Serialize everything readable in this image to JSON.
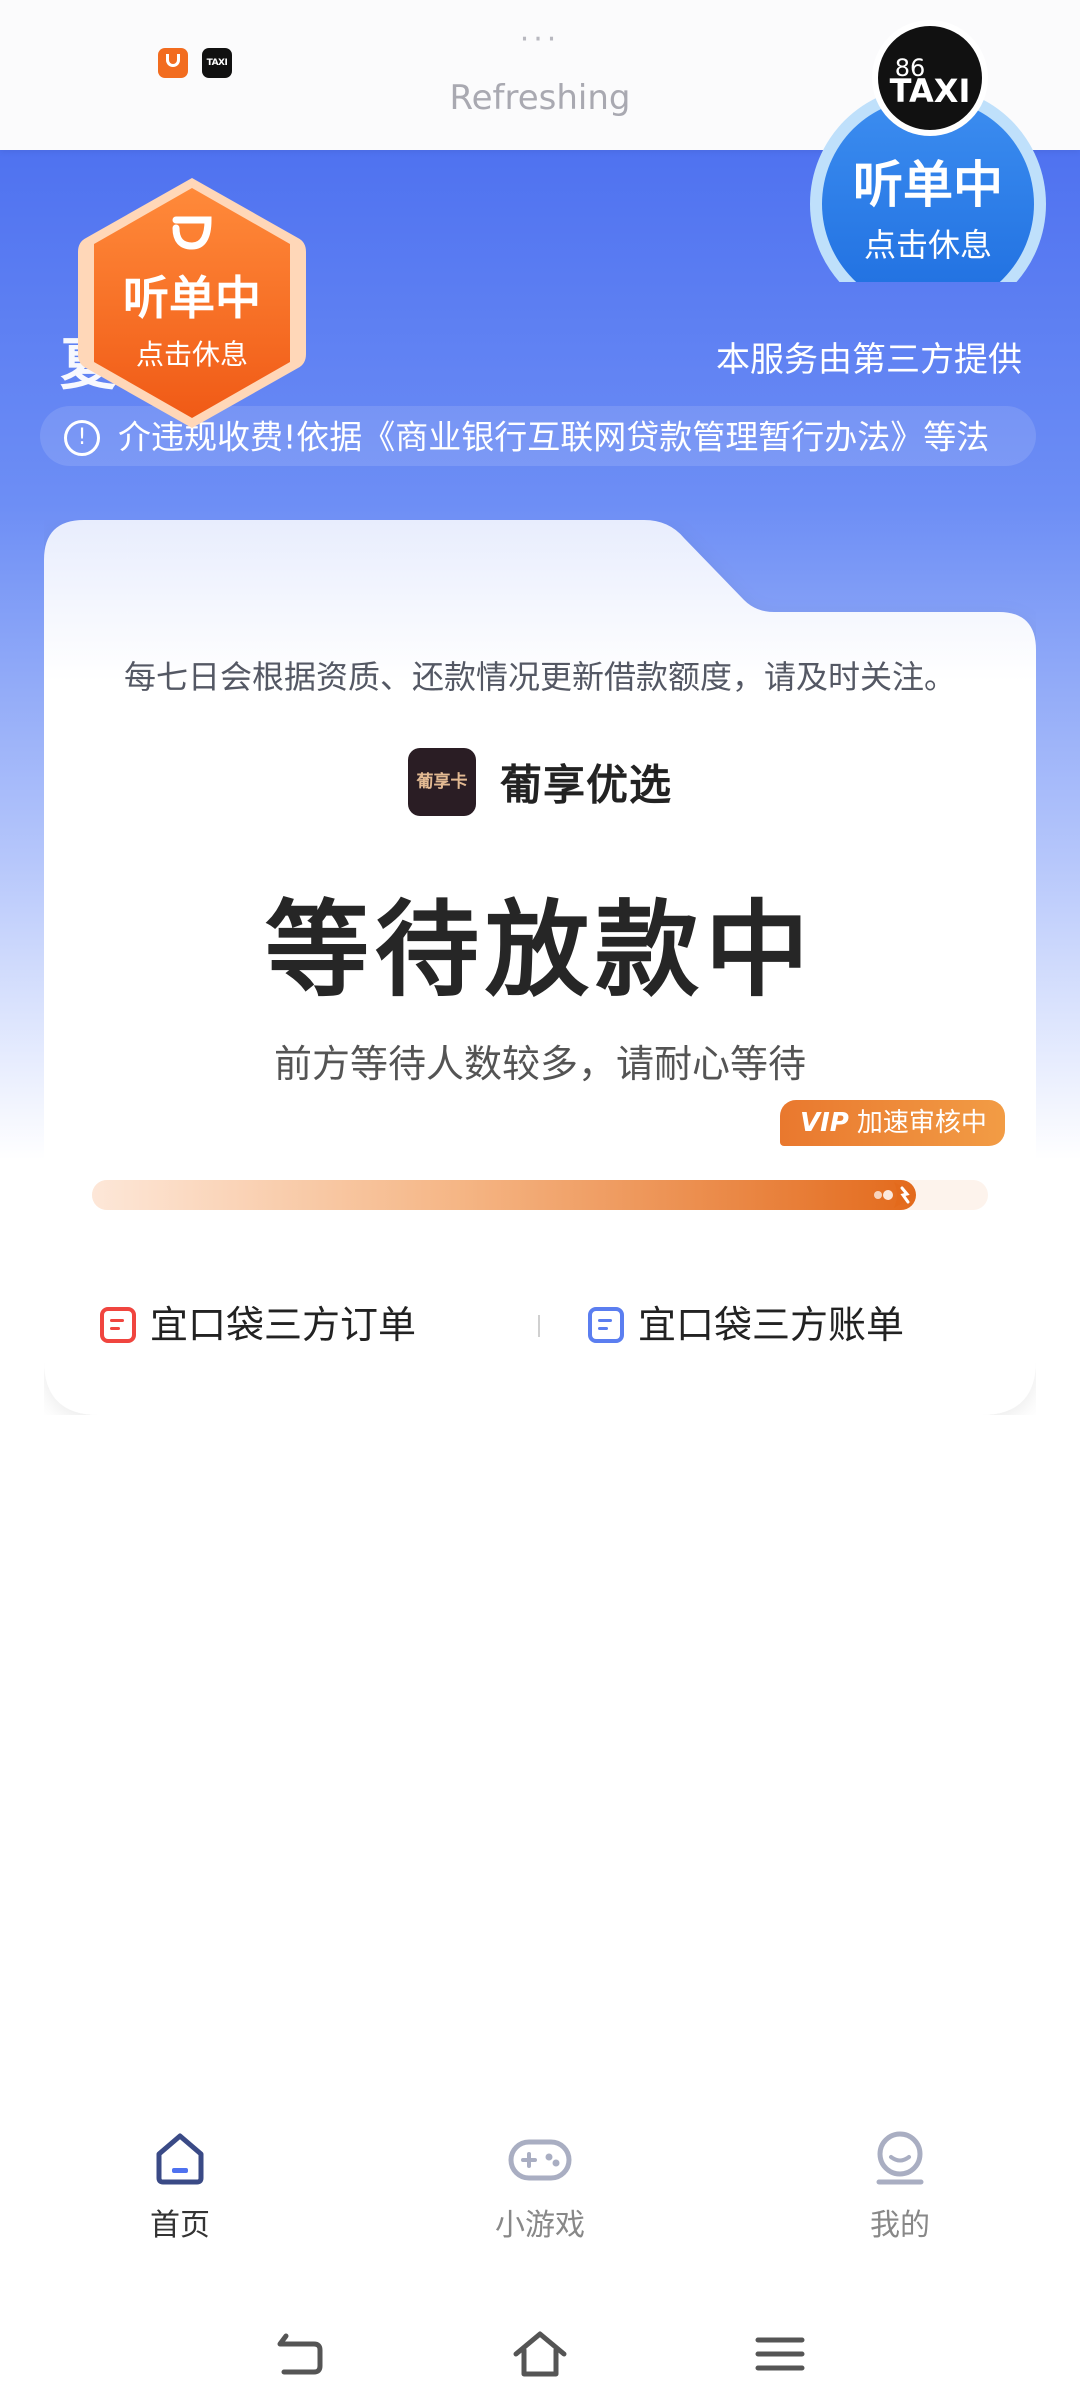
{
  "status_bar": {
    "dots": "···",
    "refreshing": "Refreshing"
  },
  "hero": {
    "title_fragment": "夏",
    "provider_note": "本服务由第三方提供",
    "notice": "介违规收费!依据《商业银行互联网贷款管理暂行办法》等法"
  },
  "floating_badges": {
    "didi": {
      "status": "听单中",
      "action": "点击休息"
    },
    "taxi": {
      "logo_number": "86",
      "logo_text": "TAXI",
      "status": "听单中",
      "action": "点击休息"
    }
  },
  "card": {
    "description": "每七日会根据资质、还款情况更新借款额度，请及时关注。",
    "brand_logo_text": "葡享卡",
    "brand_name": "葡享优选",
    "status": "等待放款中",
    "sub_status": "前方等待人数较多，请耐心等待",
    "vip_tag": "VIP",
    "vip_label": "加速审核中",
    "progress": 0.92,
    "links": {
      "orders": "宜口袋三方订单",
      "bills": "宜口袋三方账单"
    }
  },
  "tabbar": {
    "tabs": [
      {
        "label": "首页",
        "active": true
      },
      {
        "label": "小游戏",
        "active": false
      },
      {
        "label": "我的",
        "active": false
      }
    ]
  },
  "colors": {
    "brand_blue": "#4f72f0",
    "accent_orange": "#f06a1f",
    "order_icon": "#f0453f",
    "bill_icon": "#5b7ef0"
  },
  "icons": {
    "notice": "info-icon",
    "home": "home-icon",
    "games": "gamepad-icon",
    "profile": "profile-icon",
    "back": "back-icon",
    "nav_home": "nav-home-icon",
    "menu": "menu-icon"
  }
}
